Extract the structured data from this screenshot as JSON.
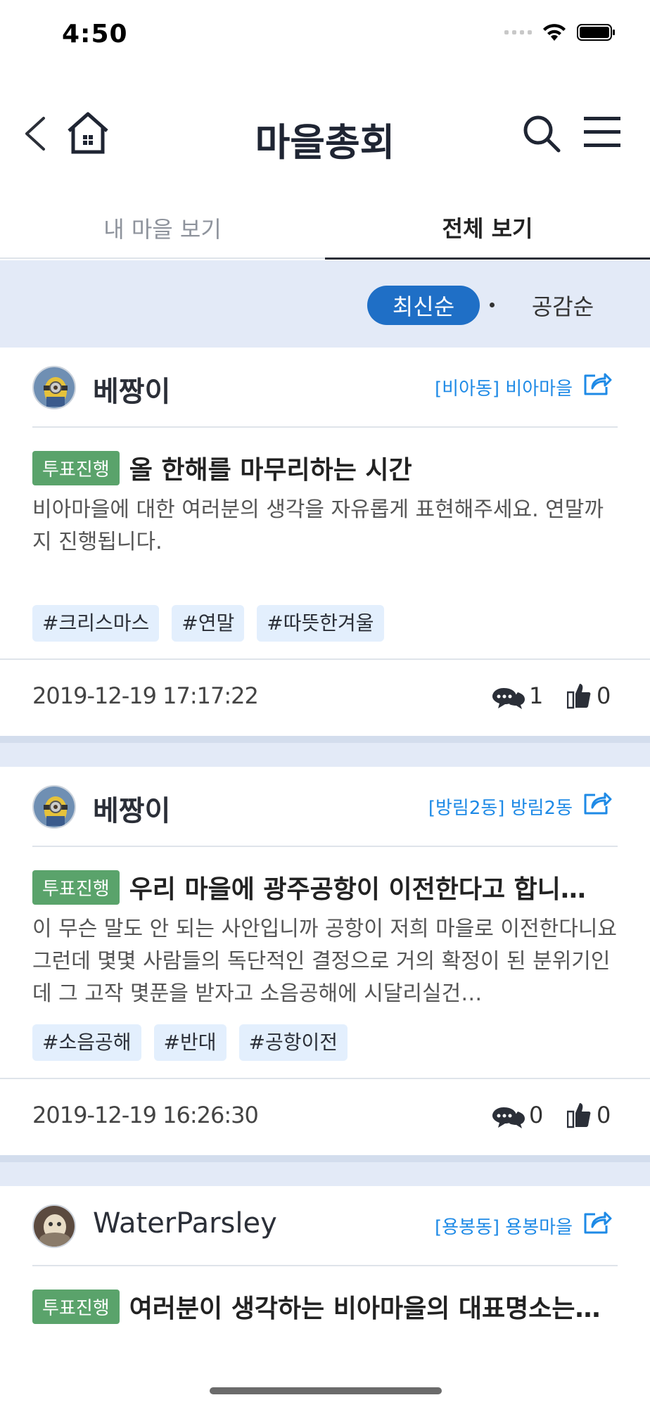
{
  "status_bar": {
    "time": "4:50"
  },
  "header": {
    "title": "마을총회"
  },
  "tabs": [
    {
      "label": "내 마을 보기"
    },
    {
      "label": "전체 보기"
    }
  ],
  "sort": {
    "latest": "최신순",
    "likes": "공감순"
  },
  "posts": [
    {
      "author": "베짱이",
      "village": "[비아동] 비아마을",
      "badge": "투표진행",
      "title": "올 한해를 마무리하는 시간",
      "text": "비아마을에 대한 여러분의 생각을 자유롭게 표현해주세요. 연말까지 진행됩니다.",
      "tags": [
        "#크리스마스",
        "#연말",
        "#따뜻한겨울"
      ],
      "date": "2019-12-19 17:17:22",
      "comments": "1",
      "likes": "0"
    },
    {
      "author": "베짱이",
      "village": "[방림2동] 방림2동",
      "badge": "투표진행",
      "title": "우리 마을에 광주공항이 이전한다고 합니…",
      "text": "이 무슨 말도 안 되는 사안입니까 공항이 저희 마을로 이전한다니요 그런데 몇몇 사람들의 독단적인 결정으로 거의 확정이 된 분위기인데 그 고작 몇푼을 받자고 소음공해에 시달리실건…",
      "tags": [
        "#소음공해",
        "#반대",
        "#공항이전"
      ],
      "date": "2019-12-19 16:26:30",
      "comments": "0",
      "likes": "0"
    },
    {
      "author": "WaterParsley",
      "village": "[용봉동] 용봉마을",
      "badge": "투표진행",
      "title": "여러분이 생각하는 비아마을의 대표명소는…"
    }
  ]
}
